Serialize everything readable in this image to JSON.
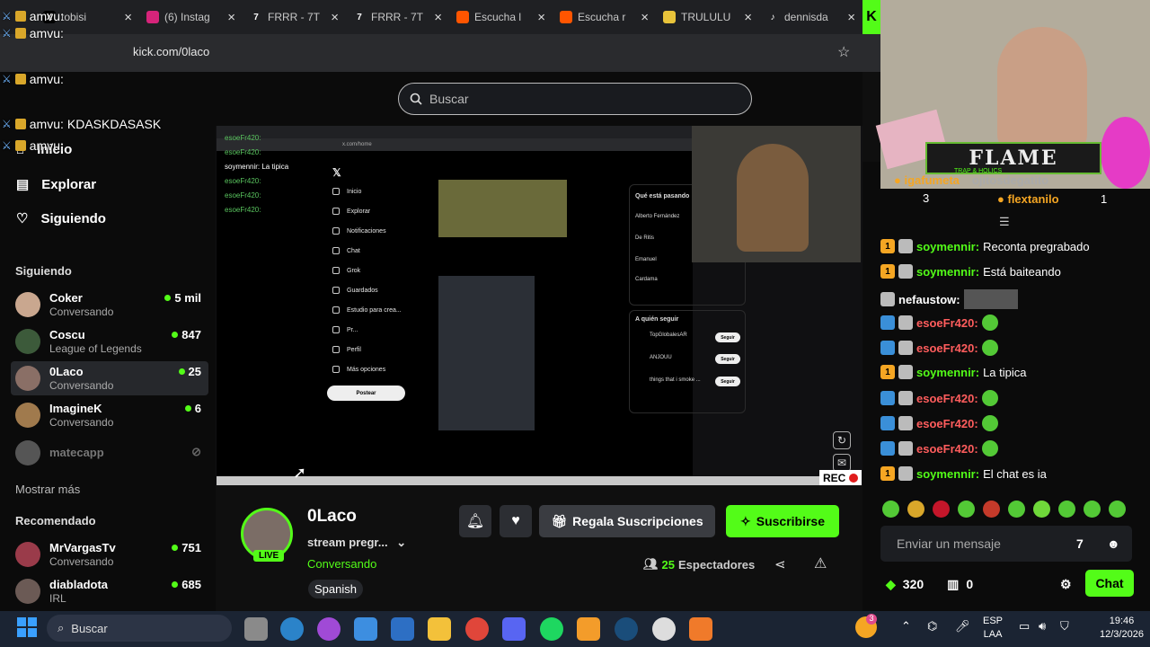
{
  "browser": {
    "tabs": [
      {
        "label": "tobisi",
        "icon": "x-icon"
      },
      {
        "label": "(6) Instag",
        "icon": "instagram-icon"
      },
      {
        "label": "FRRR - 7T",
        "icon": "frrr-icon"
      },
      {
        "label": "FRRR - 7T",
        "icon": "frrr-icon"
      },
      {
        "label": "Escucha l",
        "icon": "soundcloud-icon"
      },
      {
        "label": "Escucha r",
        "icon": "soundcloud-icon"
      },
      {
        "label": "TRULULU",
        "icon": "folder-icon"
      },
      {
        "label": "dennisda",
        "icon": "tiktok-icon"
      }
    ],
    "url": "kick.com/0laco"
  },
  "search": {
    "placeholder": "Buscar"
  },
  "nav": {
    "home": "Inicio",
    "explore": "Explorar",
    "following": "Siguiendo"
  },
  "sidebar": {
    "following_title": "Siguiendo",
    "following": [
      {
        "name": "Coker",
        "game": "Conversando",
        "viewers": "5 mil"
      },
      {
        "name": "Coscu",
        "game": "League of Legends",
        "viewers": "847"
      },
      {
        "name": "0Laco",
        "game": "Conversando",
        "viewers": "25"
      },
      {
        "name": "ImagineK",
        "game": "Conversando",
        "viewers": "6"
      },
      {
        "name": "matecapp",
        "game": "",
        "viewers": ""
      }
    ],
    "show_more": "Mostrar más",
    "recommended_title": "Recomendado",
    "recommended": [
      {
        "name": "MrVargasTv",
        "game": "Conversando",
        "viewers": "751"
      },
      {
        "name": "diabladota",
        "game": "IRL",
        "viewers": "685"
      }
    ]
  },
  "overlay_chat": [
    {
      "user": "amvu:",
      "text": ""
    },
    {
      "user": "amvu:",
      "text": ""
    },
    {
      "user": "amvu:",
      "text": ""
    },
    {
      "user": "amvu:",
      "text": "KDASKDASASK"
    },
    {
      "user": "amvu:",
      "text": ""
    }
  ],
  "video": {
    "x_nav": [
      "Inicio",
      "Explorar",
      "Notificaciones",
      "Chat",
      "Grok",
      "Guardados",
      "Estudio para crea...",
      "Pr...",
      "Perfil",
      "Más opciones"
    ],
    "post_label": "Postear",
    "trending_title": "Qué está pasando",
    "trending": [
      "Alberto Fernández",
      "De Ritis",
      "Emanuel",
      "Cardama"
    ],
    "who_follow": "A quién seguir",
    "follow_accounts": [
      "TopGlobalesAR",
      "ANJOUU",
      "things that i smoke ..."
    ],
    "follow_label": "Seguir",
    "rec_label": "REC",
    "overlay_lines": [
      "esoeFr420:",
      "esoeFr420:",
      "soymennir: La tipica",
      "esoeFr420:",
      "esoeFr420:",
      "esoeFr420:"
    ]
  },
  "stream": {
    "name": "0Laco",
    "title": "stream pregr...",
    "category": "Conversando",
    "language": "Spanish",
    "live": "LIVE",
    "gift_label": "Regala Suscripciones",
    "subscribe_label": "Suscribirse",
    "viewers_count": "25",
    "viewers_label": "Espectadores"
  },
  "webcam": {
    "banner": "FLAME",
    "banner_sub": "TRAP & HOLICS"
  },
  "chat": {
    "top": [
      {
        "user": "igafumeta",
        "count": "3"
      },
      {
        "user": "ojitosdegatito",
        "count": ""
      },
      {
        "user": "flextanilo",
        "count": "1"
      }
    ],
    "messages": [
      {
        "user": "soymennir:",
        "text": "Reconta pregrabado",
        "badge": "1",
        "color": "#53fc18"
      },
      {
        "user": "soymennir:",
        "text": "Está baiteando",
        "badge": "1",
        "color": "#53fc18"
      },
      {
        "user": "nefaustow:",
        "text": "",
        "badge": "",
        "color": "#ffffff"
      },
      {
        "user": "esoeFr420:",
        "text": "",
        "badge": "",
        "color": "#ff5d5d"
      },
      {
        "user": "esoeFr420:",
        "text": "",
        "badge": "",
        "color": "#ff5d5d"
      },
      {
        "user": "soymennir:",
        "text": "La tipica",
        "badge": "1",
        "color": "#53fc18"
      },
      {
        "user": "esoeFr420:",
        "text": "",
        "badge": "",
        "color": "#ff5d5d"
      },
      {
        "user": "esoeFr420:",
        "text": "",
        "badge": "",
        "color": "#ff5d5d"
      },
      {
        "user": "esoeFr420:",
        "text": "",
        "badge": "",
        "color": "#ff5d5d"
      },
      {
        "user": "soymennir:",
        "text": "El chat es ia",
        "badge": "1",
        "color": "#53fc18"
      }
    ],
    "input_placeholder": "Enviar un mensaje",
    "points": "320",
    "gifts": "0",
    "send_label": "Chat"
  },
  "taskbar": {
    "search": "Buscar",
    "lang_top": "ESP",
    "lang_bottom": "LAA",
    "time": "19:46",
    "date": "12/3/2026",
    "notif": "3"
  },
  "colors": {
    "accent": "#53fc18",
    "bg": "#0b0b0b"
  }
}
